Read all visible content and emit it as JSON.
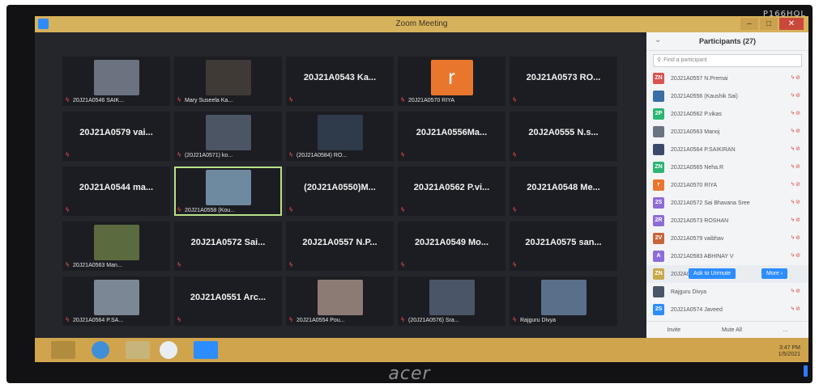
{
  "monitor": {
    "model": "P166HQL",
    "brand": "acer"
  },
  "window": {
    "title": "Zoom Meeting",
    "minimize": "–",
    "maximize": "□",
    "close": "✕"
  },
  "colors": {
    "zoom_blue": "#2d8cff",
    "muted_red": "#e2453c",
    "active_border": "#b9e089",
    "taskbar": "#cfa44d"
  },
  "grid": [
    {
      "big": "",
      "label": "20J21A0546 SAIK...",
      "photo": "photo",
      "photo_color": "#6b7280"
    },
    {
      "big": "",
      "label": "Mary Suseela Ka...",
      "photo": "photo",
      "photo_color": "#3f3a36"
    },
    {
      "big": "20J21A0543 Ka...",
      "label": ""
    },
    {
      "big": "",
      "label": "20J21A0570 RIYA",
      "photo": "letter",
      "letter": "r"
    },
    {
      "big": "20J21A0573 RO...",
      "label": ""
    },
    {
      "big": "20J21A0579 vai...",
      "label": ""
    },
    {
      "big": "",
      "label": "(20J21A0571) ko...",
      "photo": "photo",
      "photo_color": "#4b5563"
    },
    {
      "big": "",
      "label": "(20J21A0584) RO...",
      "photo": "photo",
      "photo_color": "#2f3a4a"
    },
    {
      "big": "20J21A0556Ma...",
      "label": ""
    },
    {
      "big": "20J2A0555 N.s...",
      "label": ""
    },
    {
      "big": "20J21A0544 ma...",
      "label": ""
    },
    {
      "big": "",
      "label": "20J21A0558 (Kou...",
      "photo": "photo",
      "photo_color": "#6d8aa0",
      "active": true
    },
    {
      "big": "(20J21A0550)M...",
      "label": ""
    },
    {
      "big": "20J21A0562 P.vi...",
      "label": ""
    },
    {
      "big": "20J21A0548 Me...",
      "label": ""
    },
    {
      "big": "",
      "label": "20J21A0563 Man...",
      "photo": "photo",
      "photo_color": "#5b6b3f"
    },
    {
      "big": "20J21A0572 Sai...",
      "label": ""
    },
    {
      "big": "20J21A0557 N.P...",
      "label": ""
    },
    {
      "big": "20J21A0549 Mo...",
      "label": ""
    },
    {
      "big": "20J21A0575 san...",
      "label": ""
    },
    {
      "big": "",
      "label": "20J21A0564 P.SA...",
      "photo": "photo",
      "photo_color": "#7b8794"
    },
    {
      "big": "20J21A0551 Arc...",
      "label": ""
    },
    {
      "big": "",
      "label": "20J21A0554 Pou...",
      "photo": "photo",
      "photo_color": "#8c7b74"
    },
    {
      "big": "",
      "label": "(20J21A0576) Sra...",
      "photo": "photo",
      "photo_color": "#4a5568"
    },
    {
      "big": "",
      "label": "Rajguru Divya",
      "photo": "photo",
      "photo_color": "#5a6f8a"
    }
  ],
  "participants": {
    "title": "Participants (27)",
    "search_placeholder": "Find a participant",
    "items": [
      {
        "avatar": "ZN",
        "color": "#d9534f",
        "name": "20J21A0557 N.Premai"
      },
      {
        "avatar": "",
        "color": "#3b6ea5",
        "name": "20J21A0556 (Kaushik Sai)"
      },
      {
        "avatar": "2P",
        "color": "#2bb673",
        "name": "20J21A0562 P.vikas"
      },
      {
        "avatar": "",
        "color": "#6b7280",
        "name": "20J21A0563 Manoj"
      },
      {
        "avatar": "",
        "color": "#3b4a6b",
        "name": "20J21A0564 P.SAIKIRAN"
      },
      {
        "avatar": "ZN",
        "color": "#2bb673",
        "name": "20J21A0565 Neha.R"
      },
      {
        "avatar": "r",
        "color": "#e8762d",
        "name": "20J21A0570 RIYA"
      },
      {
        "avatar": "2S",
        "color": "#8e6bd6",
        "name": "20J21A0572 Sai Bhavana Sree"
      },
      {
        "avatar": "2R",
        "color": "#8e6bd6",
        "name": "20J21A0573 ROSHAN"
      },
      {
        "avatar": "2V",
        "color": "#c8643b",
        "name": "20J21A0579 vaibhav"
      },
      {
        "avatar": "A",
        "color": "#8e6bd6",
        "name": "20J21A0583 ABHINAY V"
      },
      {
        "avatar": "ZN",
        "color": "#c8a84a",
        "name": "20J2A0..."
      },
      {
        "avatar": "",
        "color": "#4a5568",
        "name": "Rajguru Divya"
      },
      {
        "avatar": "2S",
        "color": "#2d8cff",
        "name": "20J21A0574 Javeed"
      }
    ],
    "ask_to_unmute": "Ask to Unmute",
    "more": "More ›",
    "footer_invite": "Invite",
    "footer_mute_all": "Mute All",
    "footer_more": "..."
  },
  "taskbar": {
    "time": "3:47 PM",
    "date": "1/5/2021"
  }
}
